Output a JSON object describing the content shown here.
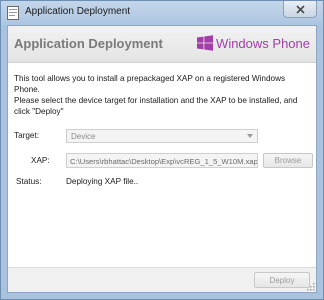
{
  "window": {
    "title": "Application Deployment"
  },
  "header": {
    "title": "Application Deployment",
    "brand": "Windows Phone"
  },
  "description": "This tool allows you to install a prepackaged XAP on a registered Windows Phone.\nPlease select the device target for installation and the XAP to be installed, and click \"Deploy\"",
  "form": {
    "target_label": "Target:",
    "target_value": "Device",
    "xap_label": "XAP:",
    "xap_value": "C:\\Users\\rbhattac\\Desktop\\Exp\\vcREG_1_5_W10M.xap",
    "browse_label": "Browse",
    "status_label": "Status:",
    "status_value": "Deploying XAP file.."
  },
  "footer": {
    "deploy_label": "Deploy"
  },
  "colors": {
    "brand": "#a33ea8",
    "frame": "#b2c9e3"
  },
  "icons": [
    "app-icon",
    "close-icon",
    "windows-flag-icon",
    "resize-grip-icon"
  ]
}
